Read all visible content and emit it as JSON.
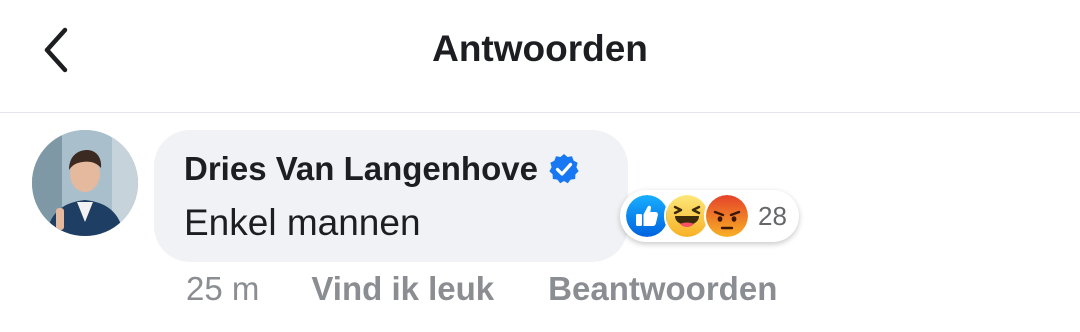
{
  "header": {
    "title": "Antwoorden",
    "back_icon": "chevron-left-icon"
  },
  "comment": {
    "author": "Dries Van Langenhove",
    "verified_icon": "verified-badge-icon",
    "text": "Enkel mannen",
    "time": "25 m",
    "actions": {
      "like": "Vind ik leuk",
      "reply": "Beantwoorden"
    },
    "reactions": {
      "icons": [
        "like-reaction-icon",
        "haha-reaction-icon",
        "angry-reaction-icon"
      ],
      "count": "28"
    }
  },
  "colors": {
    "accent_blue": "#1877f2",
    "bubble_bg": "#f0f2f5",
    "text_primary": "#1c1e21",
    "text_secondary": "#8a8d91"
  }
}
